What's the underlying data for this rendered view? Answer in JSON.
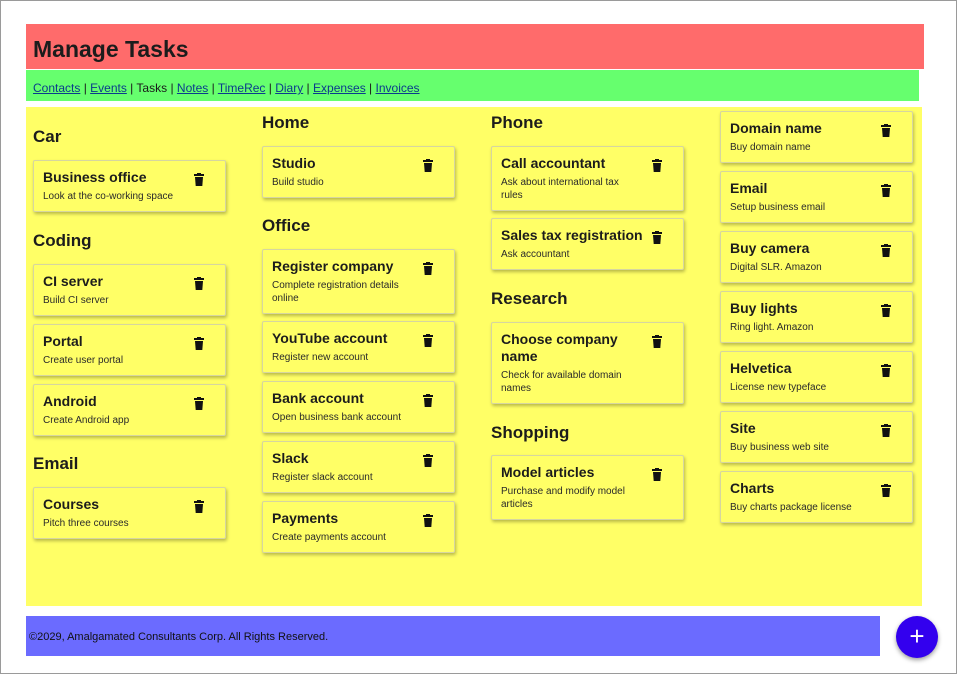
{
  "header": {
    "title": "Manage Tasks"
  },
  "nav": {
    "links": [
      "Contacts",
      "Events",
      "Tasks",
      "Notes",
      "TimeRec",
      "Diary",
      "Expenses",
      "Invoices"
    ],
    "current": "Tasks"
  },
  "columns": [
    {
      "groups": [
        {
          "title": "Car",
          "tasks": [
            {
              "title": "Business office",
              "desc": "Look at the co-working space"
            }
          ]
        },
        {
          "title": "Coding",
          "tasks": [
            {
              "title": "CI server",
              "desc": "Build CI server"
            },
            {
              "title": "Portal",
              "desc": "Create user portal"
            },
            {
              "title": "Android",
              "desc": "Create Android app"
            }
          ]
        },
        {
          "title": "Email",
          "tasks": [
            {
              "title": "Courses",
              "desc": "Pitch three courses"
            }
          ]
        }
      ]
    },
    {
      "groups": [
        {
          "title": "Home",
          "tasks": [
            {
              "title": "Studio",
              "desc": "Build studio"
            }
          ]
        },
        {
          "title": "Office",
          "tasks": [
            {
              "title": "Register company",
              "desc": "Complete registration details online"
            },
            {
              "title": "YouTube account",
              "desc": "Register new account"
            },
            {
              "title": "Bank account",
              "desc": "Open business bank account"
            },
            {
              "title": "Slack",
              "desc": "Register slack account"
            },
            {
              "title": "Payments",
              "desc": "Create payments account"
            }
          ]
        }
      ]
    },
    {
      "groups": [
        {
          "title": "Phone",
          "tasks": [
            {
              "title": "Call accountant",
              "desc": "Ask about international tax rules"
            },
            {
              "title": "Sales tax registration",
              "desc": "Ask accountant"
            }
          ]
        },
        {
          "title": "Research",
          "tasks": [
            {
              "title": "Choose company name",
              "desc": "Check for available domain names"
            }
          ]
        },
        {
          "title": "Shopping",
          "tasks": [
            {
              "title": "Model articles",
              "desc": "Purchase and modify model articles"
            }
          ]
        }
      ]
    },
    {
      "groups": [
        {
          "title": "",
          "tasks": [
            {
              "title": "Domain name",
              "desc": "Buy domain name"
            },
            {
              "title": "Email",
              "desc": "Setup business email"
            },
            {
              "title": "Buy camera",
              "desc": "Digital SLR. Amazon"
            },
            {
              "title": "Buy lights",
              "desc": "Ring light. Amazon"
            },
            {
              "title": "Helvetica",
              "desc": "License new typeface"
            },
            {
              "title": "Site",
              "desc": "Buy business web site"
            },
            {
              "title": "Charts",
              "desc": "Buy charts package license"
            }
          ]
        }
      ]
    }
  ],
  "footer": {
    "text": "©2029, Amalgamated Consultants Corp. All Rights Reserved."
  },
  "fab": {
    "label": "+",
    "icon": "plus-icon"
  },
  "colors": {
    "header_bg": "#ff6b6b",
    "nav_bg": "#66ff6e",
    "main_bg": "#ffff66",
    "footer_bg": "#6b6bff",
    "fab_bg": "#3300ee"
  }
}
